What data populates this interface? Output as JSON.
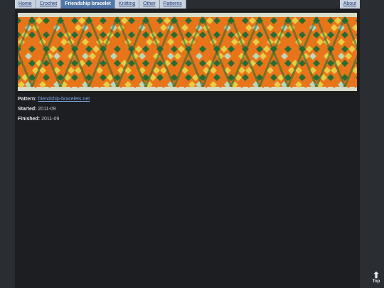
{
  "nav": {
    "tabs": [
      {
        "label": "Home",
        "active": false
      },
      {
        "label": "Crochet",
        "active": false
      },
      {
        "label": "Friendship bracelet",
        "active": true
      },
      {
        "label": "Knitting",
        "active": false
      },
      {
        "label": "Other",
        "active": false
      },
      {
        "label": "Patterns",
        "active": false
      }
    ],
    "about": "About"
  },
  "details": {
    "pattern_label": "Pattern:",
    "pattern_link": "friendship-bracelets.net",
    "started_label": "Started:",
    "started_value": "2011-09",
    "finished_label": "Finished:",
    "finished_value": "2011-09"
  },
  "scroll_top": {
    "label": "Top",
    "icon": "up-arrow-icon"
  },
  "colors": {
    "orange": "#e8751a",
    "yellow": "#e7d24a",
    "green": "#1f6b35",
    "mint": "#b8dcc0",
    "background": "#d9dcc8"
  }
}
